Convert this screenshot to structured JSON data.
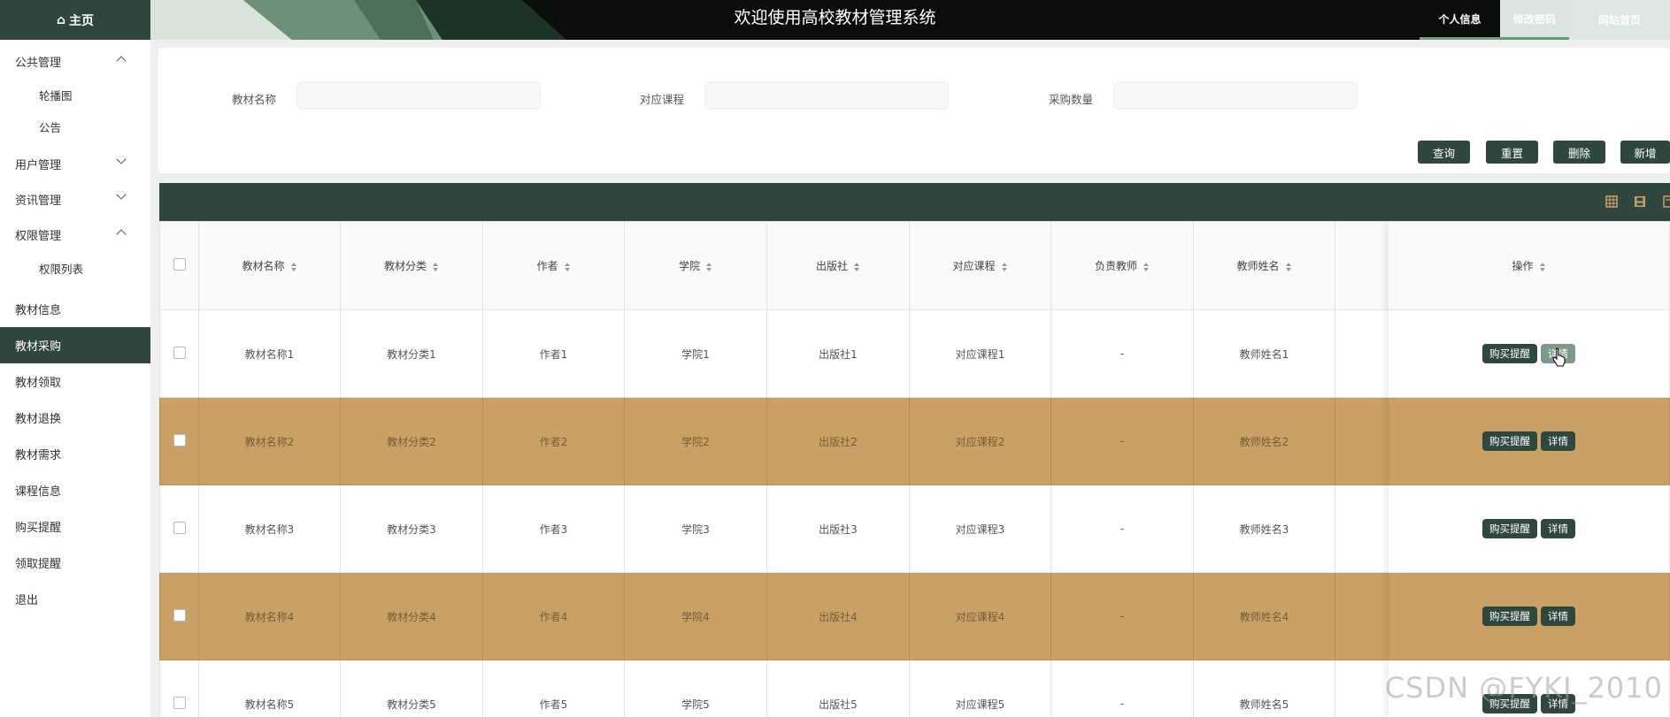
{
  "header": {
    "home_label": "主页",
    "title": "欢迎使用高校教材管理系统",
    "nav": [
      {
        "label": "个人信息"
      },
      {
        "label": "修改密码"
      },
      {
        "label": "网站首页"
      }
    ]
  },
  "sidebar": {
    "groups": [
      {
        "label": "公共管理",
        "expanded": true,
        "children": [
          "轮播图",
          "公告"
        ]
      },
      {
        "label": "用户管理",
        "expanded": false,
        "children": []
      },
      {
        "label": "资讯管理",
        "expanded": false,
        "children": []
      },
      {
        "label": "权限管理",
        "expanded": true,
        "children": [
          "权限列表"
        ]
      }
    ],
    "items": [
      "教材信息",
      "教材采购",
      "教材领取",
      "教材退换",
      "教材需求",
      "课程信息",
      "购买提醒",
      "领取提醒",
      "退出"
    ],
    "active_item": "教材采购"
  },
  "search": {
    "fields": [
      {
        "label": "教材名称",
        "value": ""
      },
      {
        "label": "对应课程",
        "value": ""
      },
      {
        "label": "采购数量",
        "value": ""
      }
    ],
    "buttons": [
      "查询",
      "重置",
      "删除",
      "新增"
    ]
  },
  "table": {
    "columns": [
      "教材名称",
      "教材分类",
      "作者",
      "学院",
      "出版社",
      "对应课程",
      "负责教师",
      "教师姓名"
    ],
    "ops_header": "操作",
    "rows": [
      [
        "教材名称1",
        "教材分类1",
        "作者1",
        "学院1",
        "出版社1",
        "对应课程1",
        "-",
        "教师姓名1"
      ],
      [
        "教材名称2",
        "教材分类2",
        "作者2",
        "学院2",
        "出版社2",
        "对应课程2",
        "-",
        "教师姓名2"
      ],
      [
        "教材名称3",
        "教材分类3",
        "作者3",
        "学院3",
        "出版社3",
        "对应课程3",
        "-",
        "教师姓名3"
      ],
      [
        "教材名称4",
        "教材分类4",
        "作者4",
        "学院4",
        "出版社4",
        "对应课程4",
        "-",
        "教师姓名4"
      ],
      [
        "教材名称5",
        "教材分类5",
        "作者5",
        "学院5",
        "出版社5",
        "对应课程5",
        "-",
        "教师姓名5"
      ]
    ],
    "row_actions": [
      "购买提醒",
      "详情"
    ],
    "toolbar_icons": [
      "columns-icon",
      "print-icon",
      "export-icon"
    ]
  },
  "colors": {
    "primary": "#2f473d",
    "striped_row": "#c9a066",
    "hover_button": "#7f9a89"
  },
  "watermark": "CSDN @FYKJ_2010"
}
